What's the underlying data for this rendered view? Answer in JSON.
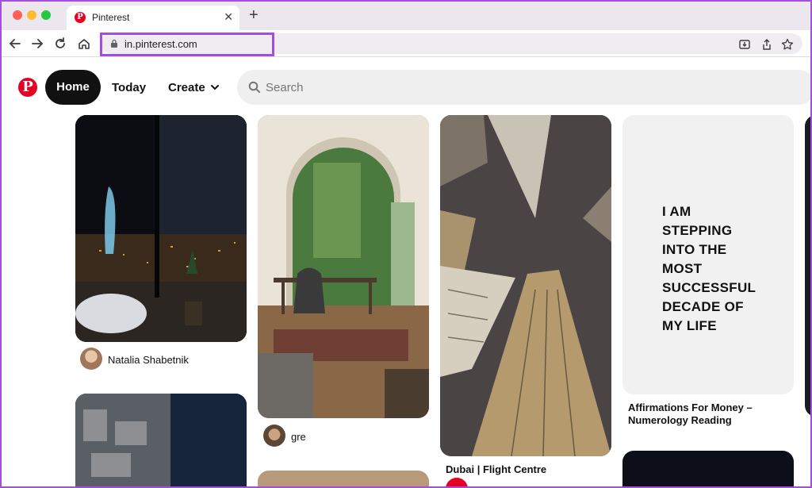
{
  "browser": {
    "tab_title": "Pinterest",
    "tab_close": "✕",
    "new_tab": "+",
    "url": "in.pinterest.com"
  },
  "header": {
    "logo_letter": "P",
    "nav": {
      "home": "Home",
      "today": "Today",
      "create": "Create"
    },
    "search_placeholder": "Search"
  },
  "pins": [
    {
      "author": "Natalia Shabetnik"
    },
    {
      "author": "gre"
    },
    {
      "caption": "Dubai | Flight Centre"
    },
    {
      "image_text": "I AM\nSTEPPING\nINTO THE\nMOST\nSUCCESSFUL\nDECADE OF\nMY LIFE",
      "caption": "Affirmations For Money – Numerology Reading"
    }
  ],
  "colors": {
    "accent_highlight": "#a44ee0",
    "pinterest_red": "#e60023",
    "home_button": "#111111"
  }
}
